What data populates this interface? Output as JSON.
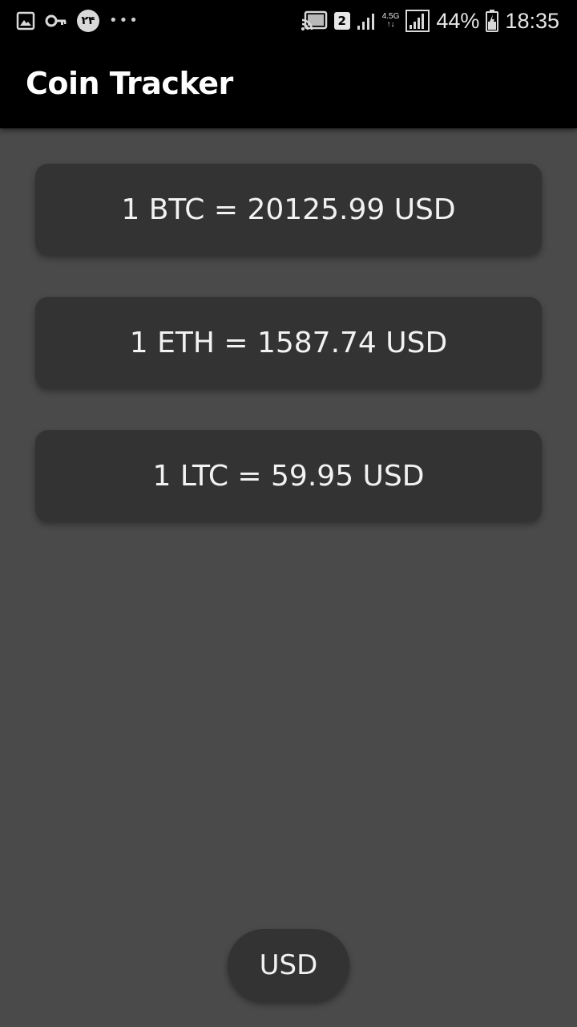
{
  "status_bar": {
    "left_icons": [
      "image-icon",
      "key-icon",
      "calendar-badge-icon",
      "more-dots-icon"
    ],
    "calendar_badge": "۲۴",
    "more_dots": "•••",
    "sim_slot": "2",
    "network_type": "4.5G",
    "battery_percent": "44%",
    "time": "18:35"
  },
  "app_bar": {
    "title": "Coin Tracker",
    "background": "#000000"
  },
  "rates": [
    {
      "text": "1 BTC = 20125.99 USD"
    },
    {
      "text": "1 ETH = 1587.74 USD"
    },
    {
      "text": "1 LTC = 59.95 USD"
    }
  ],
  "currency_selector": {
    "label": "USD"
  },
  "colors": {
    "background": "#4a4a4a",
    "card": "#333333",
    "text": "#f2f2f2"
  }
}
